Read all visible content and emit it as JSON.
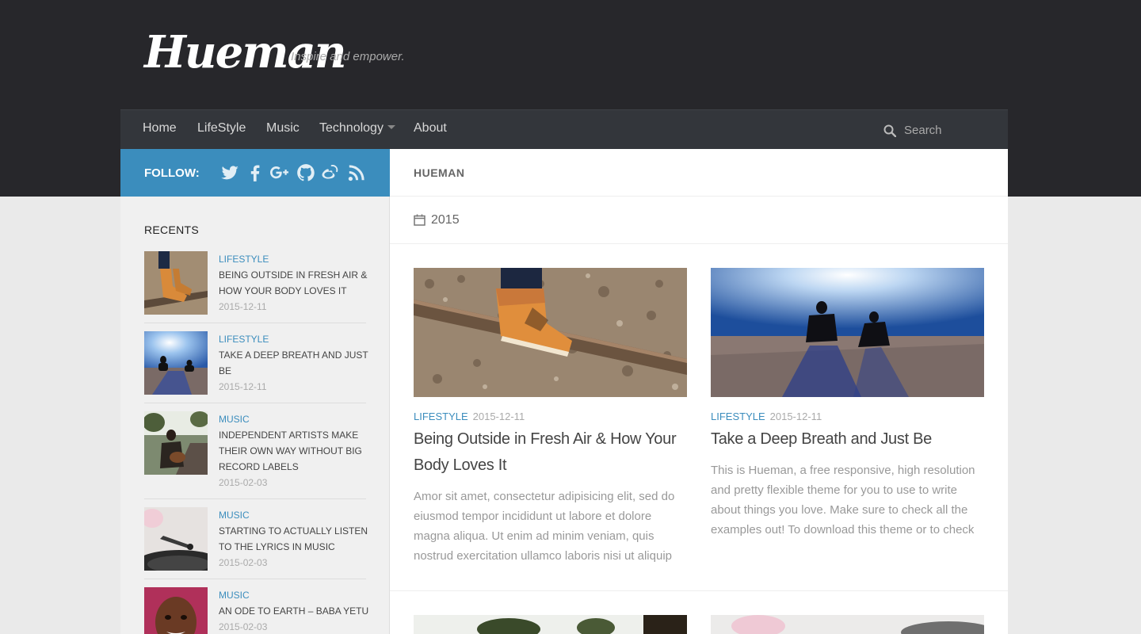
{
  "site": {
    "logo": "Hueman",
    "tagline": "Inspire and empower."
  },
  "nav": {
    "items": [
      "Home",
      "LifeStyle",
      "Music",
      "Technology",
      "About"
    ],
    "search_placeholder": "Search"
  },
  "sidebar": {
    "follow_label": "FOLLOW:",
    "social_icons": [
      "twitter-icon",
      "facebook-icon",
      "google-plus-icon",
      "github-icon",
      "weibo-icon",
      "rss-icon"
    ],
    "recents_title": "RECENTS",
    "recents": [
      {
        "category": "LIFESTYLE",
        "title": "BEING OUTSIDE IN FRESH AIR & HOW YOUR BODY LOVES IT",
        "date": "2015-12-11"
      },
      {
        "category": "LIFESTYLE",
        "title": "TAKE A DEEP BREATH AND JUST BE",
        "date": "2015-12-11"
      },
      {
        "category": "MUSIC",
        "title": "INDEPENDENT ARTISTS MAKE THEIR OWN WAY WITHOUT BIG RECORD LABELS",
        "date": "2015-02-03"
      },
      {
        "category": "MUSIC",
        "title": "STARTING TO ACTUALLY LISTEN TO THE LYRICS IN MUSIC",
        "date": "2015-02-03"
      },
      {
        "category": "MUSIC",
        "title": "AN ODE TO EARTH – BABA YETU",
        "date": "2015-02-03"
      }
    ]
  },
  "main": {
    "heading": "HUEMAN",
    "year": "2015",
    "posts": [
      {
        "category": "LIFESTYLE",
        "date": "2015-12-11",
        "title": "Being Outside in Fresh Air & How Your Body Loves It",
        "excerpt": "Amor sit amet, consectetur adipisicing elit, sed do eiusmod tempor incididunt ut labore et dolore magna aliqua. Ut enim ad minim veniam, quis nostrud exercitation ullamco laboris nisi ut aliquip"
      },
      {
        "category": "LIFESTYLE",
        "date": "2015-12-11",
        "title": "Take a Deep Breath and Just Be",
        "excerpt": "This is Hueman, a free responsive, high resolution and pretty flexible theme for you to use to write about things you love. Make sure to check all the examples out! To download this theme or to check"
      }
    ]
  },
  "colors": {
    "accent": "#3b8dbd",
    "header_bg": "#27272b",
    "nav_bg": "#33363b"
  }
}
